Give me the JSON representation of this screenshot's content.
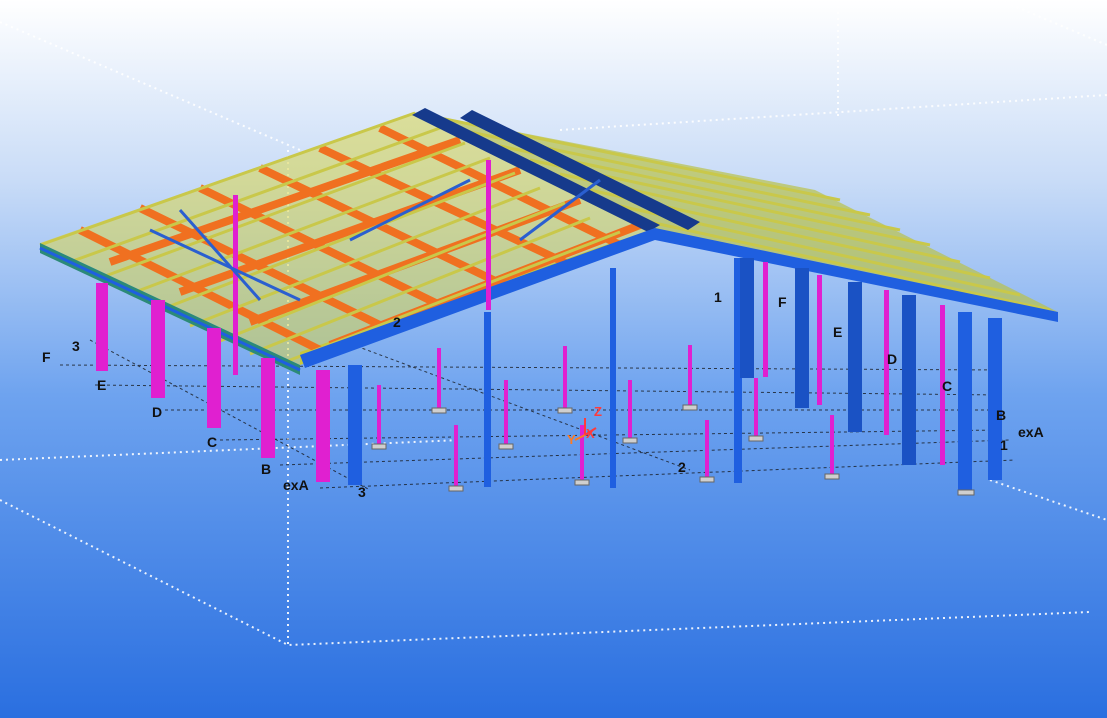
{
  "grid_labels": {
    "left_rows": [
      "F",
      "E",
      "D",
      "C",
      "B",
      "exA"
    ],
    "left_axis_number": "3",
    "front_columns": [
      "3",
      "2"
    ],
    "right_rows": [
      "F",
      "E",
      "D",
      "C",
      "B",
      "exA"
    ],
    "right_axis_number": "1",
    "back_column_number": "1",
    "mid_number": "2"
  },
  "axis_triad": {
    "z": "Z",
    "y": "Y",
    "x": "X"
  },
  "colors": {
    "bg_top": "#ffffff",
    "bg_bottom": "#2f7ae8",
    "roof_purlin": "#c8c83c",
    "roof_rafter": "#f07020",
    "frame_blue": "#1f5fe0",
    "column_magenta": "#e020d0",
    "ridge_dark": "#163a8c",
    "axis_z": "#ff3b3b",
    "axis_x": "#ff3b3b",
    "axis_y": "#ff7a20"
  }
}
